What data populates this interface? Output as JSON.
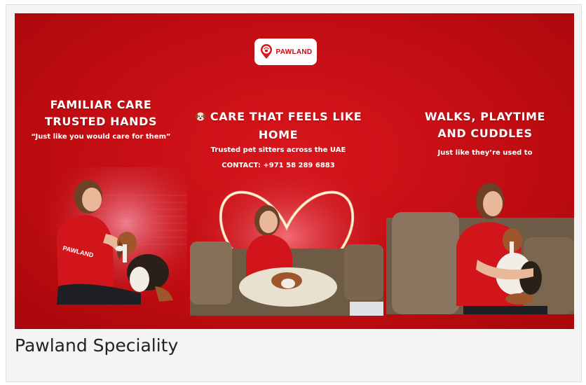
{
  "banner": {
    "logo": {
      "text": "PAWLAND",
      "icon": "paw-pin-icon"
    },
    "panels": [
      {
        "headline_line1": "FAMILIAR CARE",
        "headline_line2": "TRUSTED HANDS",
        "subtitle": "“Just like you would care for them”"
      },
      {
        "headline_line1": "CARE THAT FEELS LIKE",
        "headline_line2": "HOME",
        "headline_icon": "dog-face-icon",
        "subtitle": "Trusted pet sitters across the UAE",
        "contact": "CONTACT: +971 58 289 6883"
      },
      {
        "headline_line1": "WALKS, PLAYTIME",
        "headline_line2": "AND CUDDLES",
        "subtitle": "Just like they’re used to"
      }
    ],
    "shirt_print": "PAWLAND",
    "colors": {
      "background": "#c10d12",
      "text": "#ffffff"
    }
  },
  "caption": "Pawland Speciality"
}
